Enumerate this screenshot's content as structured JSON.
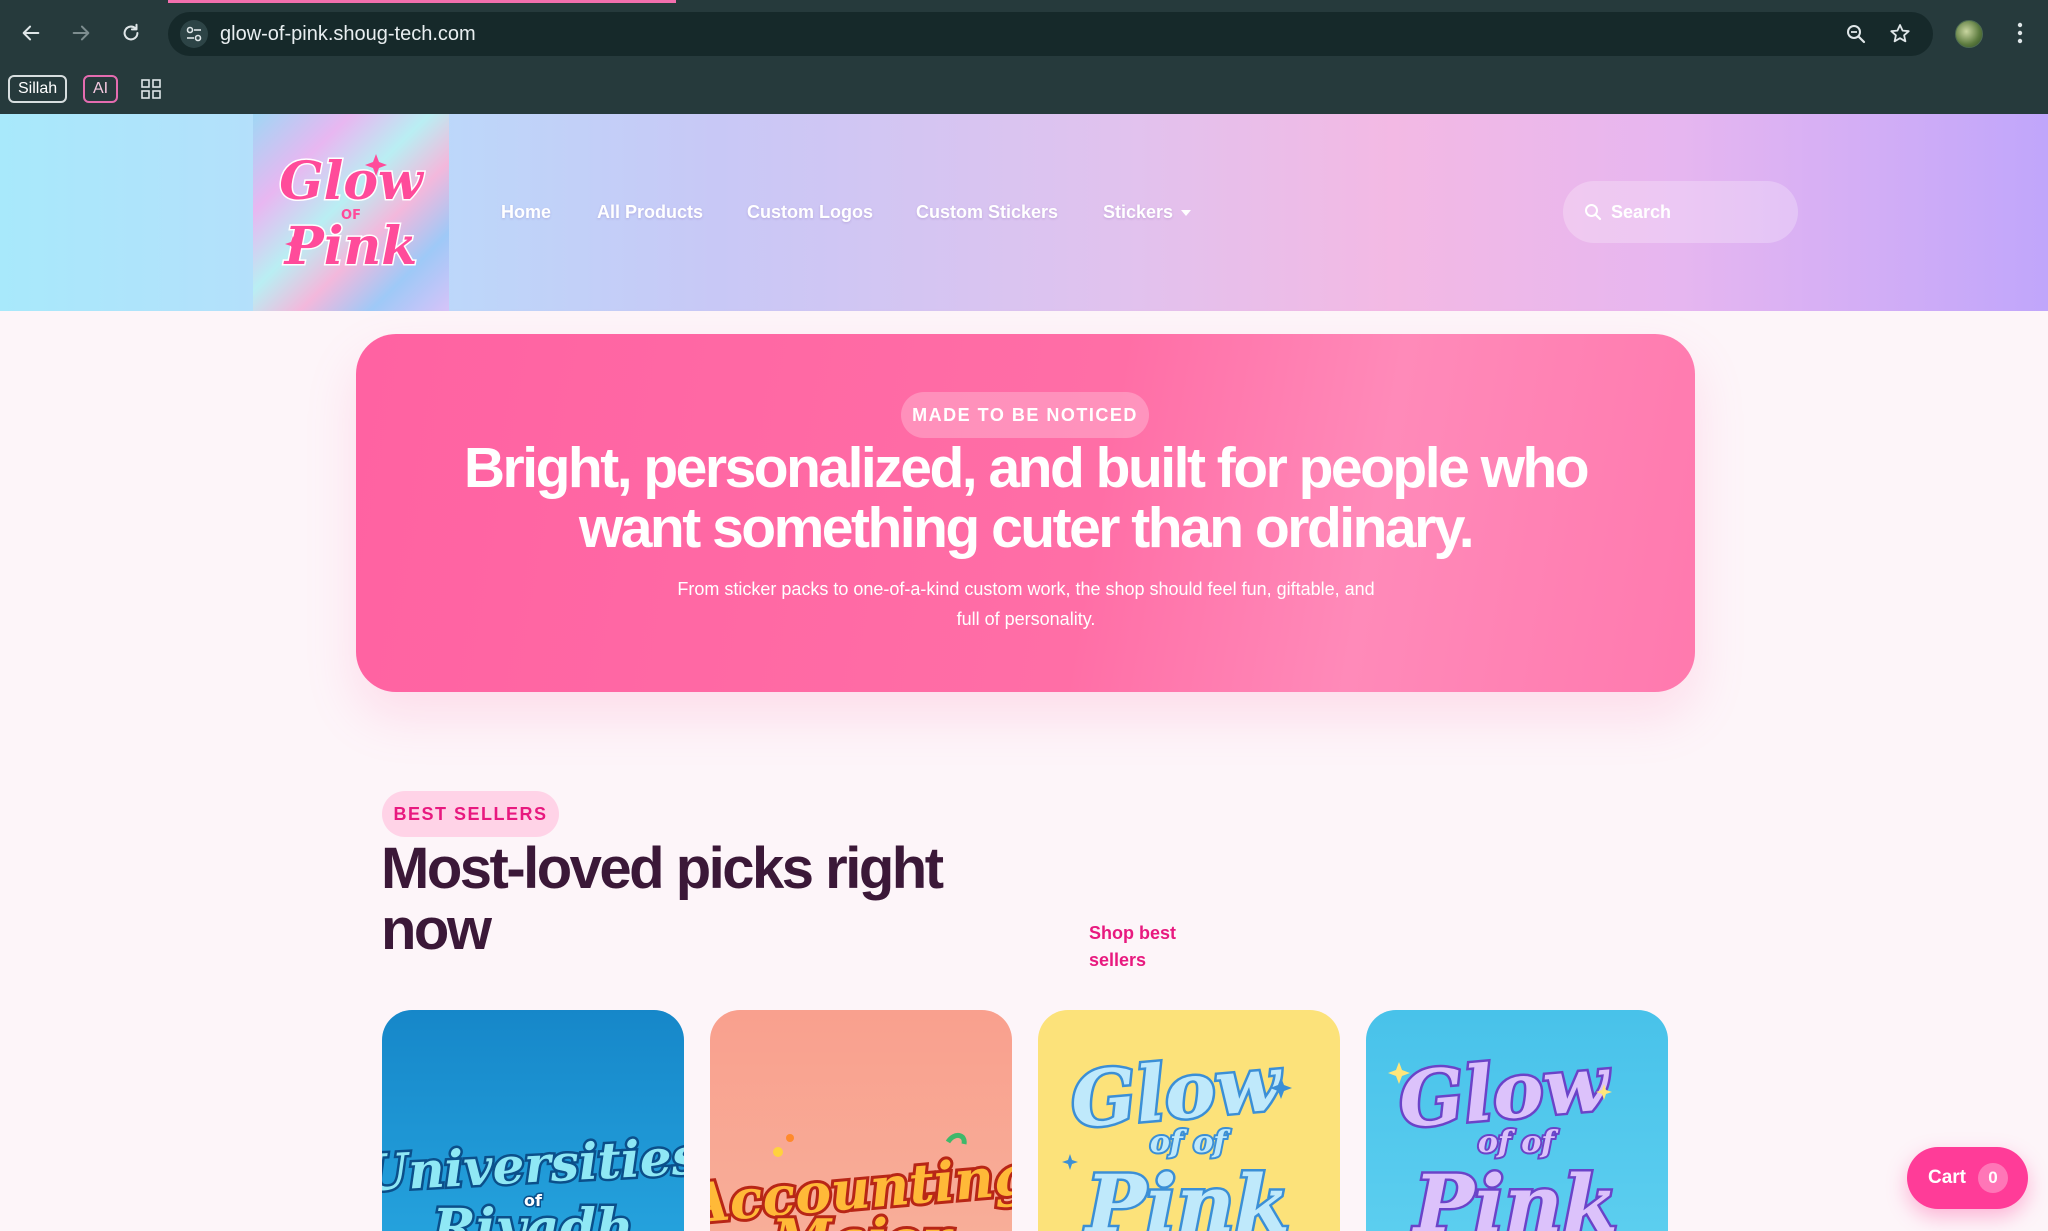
{
  "browser": {
    "url": "glow-of-pink.shoug-tech.com",
    "bookmarks": [
      {
        "label": "Sillah"
      },
      {
        "label": "AI"
      }
    ]
  },
  "header": {
    "logo_text": "Glow of Pink",
    "nav": [
      "Home",
      "All Products",
      "Custom Logos",
      "Custom Stickers",
      "Stickers"
    ],
    "search_placeholder": "Search"
  },
  "hero": {
    "badge": "MADE TO BE NOTICED",
    "title_line1": "Bright, personalized, and built for people who",
    "title_line2": "want something cuter than ordinary.",
    "subtitle_line1": "From sticker packs to one-of-a-kind custom work, the shop should feel fun, giftable, and",
    "subtitle_line2": "full of personality."
  },
  "best_sellers": {
    "badge": "BEST SELLERS",
    "title_line1": "Most-loved picks right",
    "title_line2": "now",
    "link_line1": "Shop best",
    "link_line2": "sellers",
    "cards": [
      {
        "image_text": "Universities of Riyadh",
        "bg": "#1f9ad8"
      },
      {
        "image_text": "Accounting Major",
        "bg": "#f7a08a"
      },
      {
        "image_text": "Glow of Pink",
        "bg": "#fbe276"
      },
      {
        "image_text": "Glow of Pink",
        "bg": "#4dc6ea"
      }
    ]
  },
  "cart": {
    "label": "Cart",
    "count": "0"
  },
  "colors": {
    "accent": "#e8197f",
    "hero": "#ff6ea6",
    "cart": "#ff3c98",
    "title": "#3b1838"
  }
}
